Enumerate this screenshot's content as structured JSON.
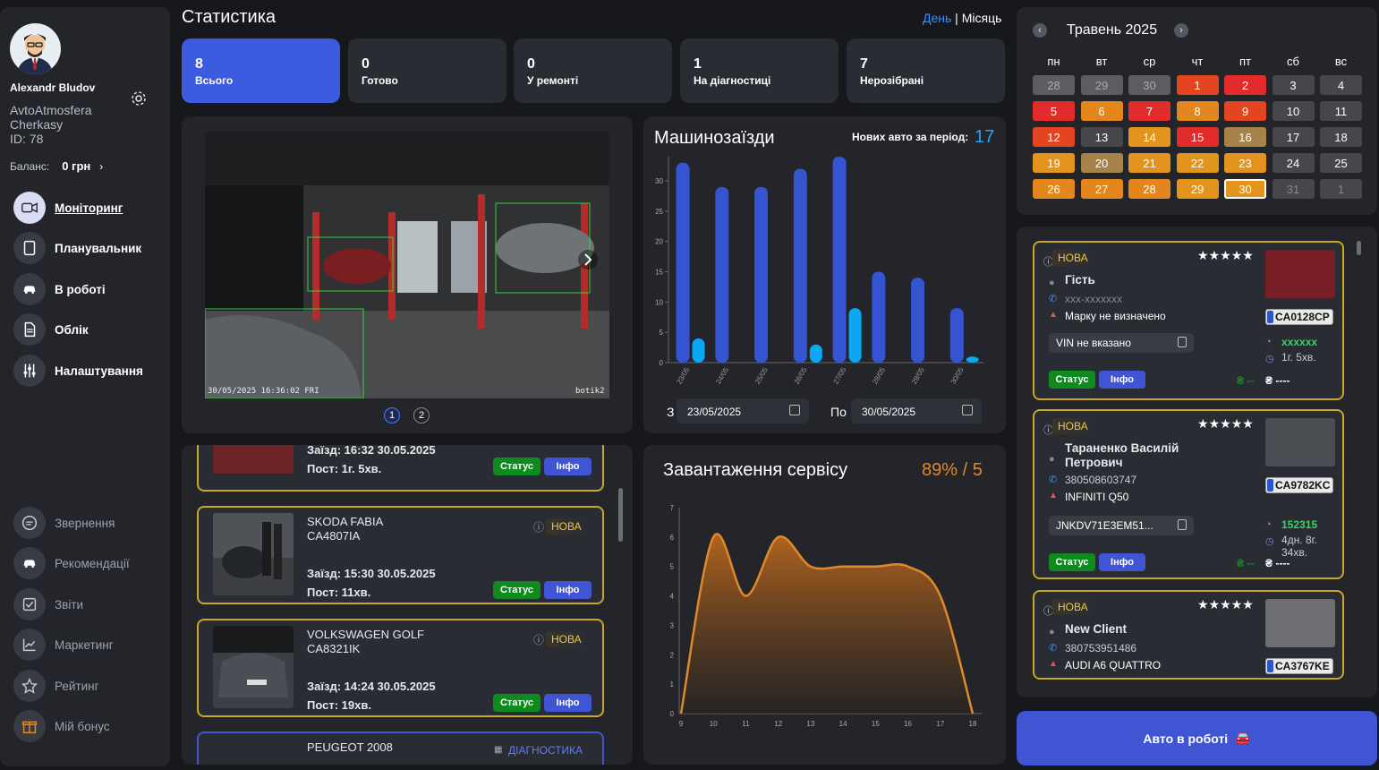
{
  "user": {
    "name": "Alexandr Bludov",
    "org": "AvtoAtmosfera",
    "city": "Cherkasy",
    "id": "ID: 78",
    "balance_label": "Баланс:",
    "balance": "0 грн"
  },
  "nav": [
    {
      "label": "Моніторинг",
      "icon": "camera-icon"
    },
    {
      "label": "Планувальник",
      "icon": "tablet-icon"
    },
    {
      "label": "В роботі",
      "icon": "car-icon"
    },
    {
      "label": "Облік",
      "icon": "document-icon"
    },
    {
      "label": "Налаштування",
      "icon": "sliders-icon"
    }
  ],
  "nav_bottom": [
    {
      "label": "Звернення",
      "icon": "chat-icon"
    },
    {
      "label": "Рекомендації",
      "icon": "car-icon"
    },
    {
      "label": "Звіти",
      "icon": "checklist-icon"
    },
    {
      "label": "Маркетинг",
      "icon": "trend-icon"
    },
    {
      "label": "Рейтинг",
      "icon": "star-icon"
    },
    {
      "label": "Мій бонус",
      "icon": "gift-icon"
    }
  ],
  "stats": {
    "title": "Статистика",
    "period_day": "День",
    "period_sep": " | ",
    "period_month": "Місяць",
    "cards": [
      {
        "n": "8",
        "t": "Всього"
      },
      {
        "n": "0",
        "t": "Готово"
      },
      {
        "n": "0",
        "t": "У ремонті"
      },
      {
        "n": "1",
        "t": "На діагностиці"
      },
      {
        "n": "7",
        "t": "Нерозібрані"
      }
    ]
  },
  "camera": {
    "timestamp": "30/05/2025 16:36:02 FRI",
    "cam_name": "botik2",
    "pages": [
      "1",
      "2"
    ]
  },
  "visits": {
    "title": "Машинозаїзди",
    "new_label": "Нових авто за період:",
    "new_count": "17",
    "from_label": "З",
    "from": "23/05/2025",
    "to_label": "По",
    "to": "30/05/2025"
  },
  "load": {
    "title": "Завантаження сервісу",
    "value": "89% / 5"
  },
  "chart_data": [
    {
      "type": "bar",
      "title": "Машинозаїзди",
      "categories": [
        "23/05",
        "24/05",
        "25/05",
        "26/05",
        "27/05",
        "28/05",
        "29/05",
        "30/05"
      ],
      "series": [
        {
          "values": [
            33,
            29,
            29,
            32,
            34,
            15,
            14,
            9
          ],
          "color": "#3554d1"
        },
        {
          "values": [
            4,
            0,
            0,
            3,
            9,
            0,
            0,
            1
          ],
          "color": "#0aa7f5"
        }
      ],
      "ylim": [
        0,
        34
      ],
      "yticks": [
        0,
        5,
        10,
        15,
        20,
        25,
        30
      ]
    },
    {
      "type": "area",
      "title": "Завантаження сервісу",
      "x": [
        9,
        10,
        11,
        12,
        13,
        14,
        15,
        16,
        17,
        18
      ],
      "y": [
        0,
        6,
        4,
        6,
        5,
        5,
        5,
        5,
        4,
        0
      ],
      "xlim": [
        9,
        18
      ],
      "ylim": [
        0,
        7
      ],
      "yticks": [
        0,
        1,
        2,
        3,
        4,
        5,
        6,
        7
      ],
      "color": "#e0892a"
    }
  ],
  "calendar": {
    "month": "Травень 2025",
    "weekdays": [
      "пн",
      "вт",
      "ср",
      "чт",
      "пт",
      "сб",
      "вс"
    ],
    "days": [
      {
        "d": "28",
        "c": "#5b5d62",
        "f": "#aaa"
      },
      {
        "d": "29",
        "c": "#5b5d62",
        "f": "#aaa"
      },
      {
        "d": "30",
        "c": "#5b5d62",
        "f": "#aaa"
      },
      {
        "d": "1",
        "c": "#e2451f"
      },
      {
        "d": "2",
        "c": "#e22b2b"
      },
      {
        "d": "3",
        "c": "#45474d"
      },
      {
        "d": "4",
        "c": "#45474d"
      },
      {
        "d": "5",
        "c": "#e22b2b"
      },
      {
        "d": "6",
        "c": "#e3861e"
      },
      {
        "d": "7",
        "c": "#e22b2b"
      },
      {
        "d": "8",
        "c": "#e3861e"
      },
      {
        "d": "9",
        "c": "#e2451f"
      },
      {
        "d": "10",
        "c": "#45474d"
      },
      {
        "d": "11",
        "c": "#45474d"
      },
      {
        "d": "12",
        "c": "#e2451f"
      },
      {
        "d": "13",
        "c": "#45474d"
      },
      {
        "d": "14",
        "c": "#e3941e"
      },
      {
        "d": "15",
        "c": "#e22b2b"
      },
      {
        "d": "16",
        "c": "#a5834a"
      },
      {
        "d": "17",
        "c": "#45474d"
      },
      {
        "d": "18",
        "c": "#45474d"
      },
      {
        "d": "19",
        "c": "#e3941e"
      },
      {
        "d": "20",
        "c": "#a5834a"
      },
      {
        "d": "21",
        "c": "#e3941e"
      },
      {
        "d": "22",
        "c": "#e3941e"
      },
      {
        "d": "23",
        "c": "#e3941e"
      },
      {
        "d": "24",
        "c": "#45474d"
      },
      {
        "d": "25",
        "c": "#45474d"
      },
      {
        "d": "26",
        "c": "#e3861e"
      },
      {
        "d": "27",
        "c": "#e3861e"
      },
      {
        "d": "28",
        "c": "#e3861e"
      },
      {
        "d": "29",
        "c": "#e3941e"
      },
      {
        "d": "30",
        "c": "#e3941e",
        "sel": true
      },
      {
        "d": "31",
        "c": "#45474d",
        "f": "#888"
      },
      {
        "d": "1",
        "c": "#45474d",
        "f": "#888"
      }
    ]
  },
  "visit_list": [
    {
      "entry": "Заїзд: 16:32 30.05.2025",
      "post": "Пост: 1г. 5хв."
    },
    {
      "model": "SKODA FABIA",
      "plate": "CA4807IA",
      "badge": "НОВА",
      "entry": "Заїзд: 15:30 30.05.2025",
      "post": "Пост: 11хв."
    },
    {
      "model": "VOLKSWAGEN GOLF",
      "plate": "CA8321IK",
      "badge": "НОВА",
      "entry": "Заїзд: 14:24 30.05.2025",
      "post": "Пост: 19хв."
    },
    {
      "model": "PEUGEOT 2008",
      "badge": "ДІАГНОСТИКА"
    }
  ],
  "btn_status": "Статус",
  "btn_info": "Інфо",
  "clients": [
    {
      "badge": "НОВА",
      "name": "Гість",
      "phone": "xxx-xxxxxxx",
      "car": "Марку не визначено",
      "vin": "VIN не вказано",
      "plate": "CA0128CP",
      "mileage": "xxxxxx",
      "time": "1г. 5хв.",
      "money1": "₴ --",
      "money2": "₴ ----"
    },
    {
      "badge": "НОВА",
      "name": "Тараненко Василій Петрович",
      "phone": "380508603747",
      "car": "INFINITI Q50",
      "vin": "JNKDV71E3EM51...",
      "plate": "CA9782KC",
      "mileage": "152315",
      "time": "4дн. 8г. 34хв.",
      "money1": "₴ --",
      "money2": "₴ ----"
    },
    {
      "badge": "НОВА",
      "name": "New Client",
      "phone": "380753951486",
      "car": "AUDI A6 QUATTRO",
      "plate": "CA3767KE"
    }
  ],
  "in_work_button": "Авто в роботі"
}
